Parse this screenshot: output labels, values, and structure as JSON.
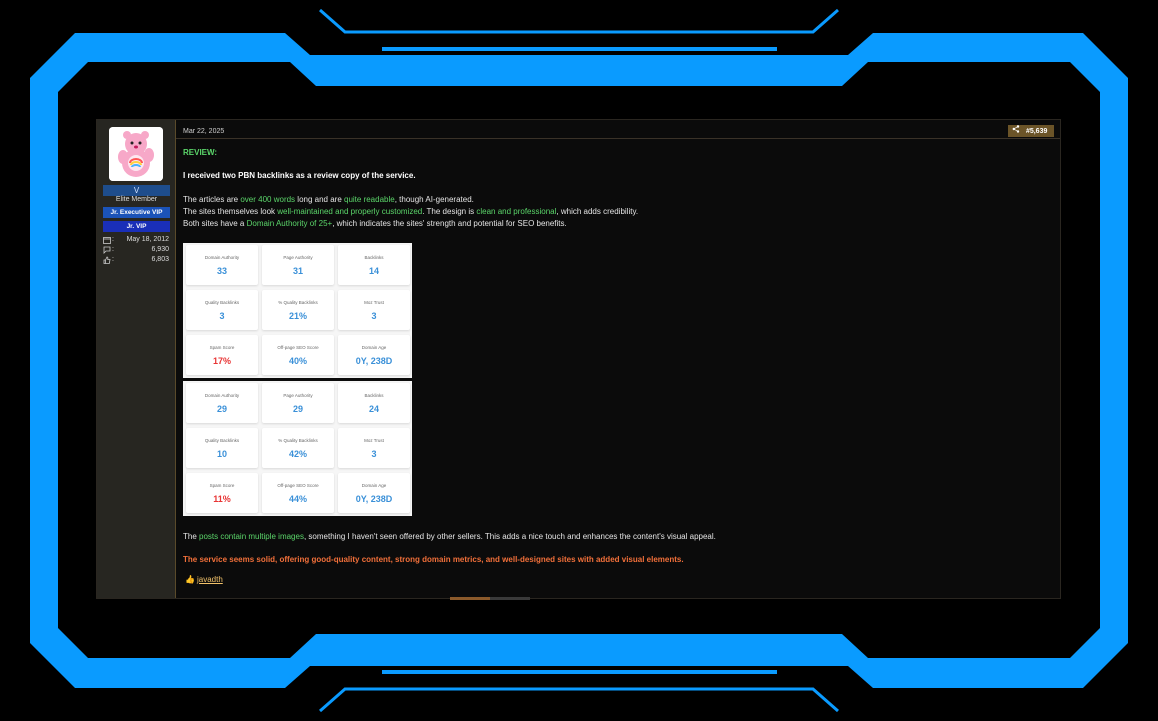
{
  "post": {
    "date": "Mar 22, 2025",
    "number": "#5,639"
  },
  "user": {
    "name": "V",
    "title": "Elite Member",
    "banner_exec": "Jr. Executive VIP",
    "banner_vip": "Jr. VIP",
    "joined": "May 18, 2012",
    "messages": "6,930",
    "reactions": "6,803"
  },
  "content": {
    "review_heading": "REVIEW:",
    "intro": "I received two PBN backlinks as a review copy of the service.",
    "p1_a": "The articles are ",
    "p1_b": "over 400 words",
    "p1_c": " long and are ",
    "p1_d": "quite readable",
    "p1_e": ", though AI-generated.",
    "p2_a": "The sites themselves look ",
    "p2_b": "well-maintained and properly customized",
    "p2_c": ". The design is ",
    "p2_d": "clean and professional",
    "p2_e": ", which adds credibility.",
    "p3_a": "Both sites have a ",
    "p3_b": "Domain Authority of 25+",
    "p3_c": ", which indicates the sites' strength and potential for SEO benefits.",
    "p4_a": "The ",
    "p4_b": "posts contain multiple images",
    "p4_c": ", something I haven't seen offered by other sellers. This adds a nice touch and enhances the content's visual appeal.",
    "conclusion": "The service seems solid, offering good-quality content, strong domain metrics, and well-designed sites with added visual elements."
  },
  "metrics1": [
    {
      "label": "Domain Authority",
      "value": "33"
    },
    {
      "label": "Page Authority",
      "value": "31"
    },
    {
      "label": "Backlinks",
      "value": "14"
    },
    {
      "label": "Quality Backlinks",
      "value": "3"
    },
    {
      "label": "% Quality Backlinks",
      "value": "21%"
    },
    {
      "label": "Moz Trust",
      "value": "3"
    },
    {
      "label": "Spam Score",
      "value": "17%"
    },
    {
      "label": "Off-page SEO Score",
      "value": "40%"
    },
    {
      "label": "Domain Age",
      "value": "0Y, 238D"
    }
  ],
  "metrics2": [
    {
      "label": "Domain Authority",
      "value": "29"
    },
    {
      "label": "Page Authority",
      "value": "29"
    },
    {
      "label": "Backlinks",
      "value": "24"
    },
    {
      "label": "Quality Backlinks",
      "value": "10"
    },
    {
      "label": "% Quality Backlinks",
      "value": "42%"
    },
    {
      "label": "Moz Trust",
      "value": "3"
    },
    {
      "label": "Spam Score",
      "value": "11%"
    },
    {
      "label": "Off-page SEO Score",
      "value": "44%"
    },
    {
      "label": "Domain Age",
      "value": "0Y, 238D"
    }
  ],
  "reaction_user": "javadth",
  "colors": {
    "frame": "#0a9bff",
    "accent_green": "#5bd66a",
    "accent_orange": "#f2703a",
    "metric_blue": "#3a90d8",
    "metric_red": "#e83535"
  }
}
